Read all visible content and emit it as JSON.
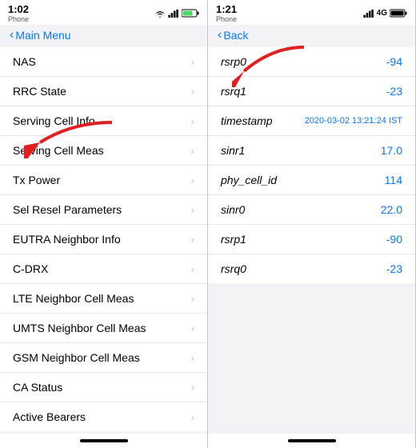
{
  "left_panel": {
    "status": {
      "time": "1:02",
      "label": "Phone",
      "icons": "wifi signal battery"
    },
    "nav": {
      "back_label": "Main Menu"
    },
    "items": [
      {
        "label": "NAS",
        "has_chevron": true
      },
      {
        "label": "RRC State",
        "has_chevron": true
      },
      {
        "label": "Serving Cell Info",
        "has_chevron": true
      },
      {
        "label": "Serving Cell Meas",
        "has_chevron": true
      },
      {
        "label": "Tx Power",
        "has_chevron": true
      },
      {
        "label": "Sel Resel Parameters",
        "has_chevron": true
      },
      {
        "label": "EUTRA Neighbor Info",
        "has_chevron": true
      },
      {
        "label": "C-DRX",
        "has_chevron": true
      },
      {
        "label": "LTE Neighbor Cell Meas",
        "has_chevron": true
      },
      {
        "label": "UMTS Neighbor Cell Meas",
        "has_chevron": true
      },
      {
        "label": "GSM Neighbor Cell Meas",
        "has_chevron": true
      },
      {
        "label": "CA Status",
        "has_chevron": true
      },
      {
        "label": "Active Bearers",
        "has_chevron": true
      }
    ]
  },
  "right_panel": {
    "status": {
      "time": "1:21",
      "label": "Phone",
      "icons": "signal 4G battery"
    },
    "nav": {
      "back_label": "Back"
    },
    "items": [
      {
        "key": "rsrp0",
        "value": "-94"
      },
      {
        "key": "rsrq1",
        "value": "-23"
      },
      {
        "key": "timestamp",
        "value": "2020-03-02 13:21:24 IST",
        "is_timestamp": true
      },
      {
        "key": "sinr1",
        "value": "17.0"
      },
      {
        "key": "phy_cell_id",
        "value": "114"
      },
      {
        "key": "sinr0",
        "value": "22.0"
      },
      {
        "key": "rsrp1",
        "value": "-90"
      },
      {
        "key": "rsrq0",
        "value": "-23"
      }
    ]
  },
  "icons": {
    "chevron": "›",
    "back_chevron": "‹"
  }
}
